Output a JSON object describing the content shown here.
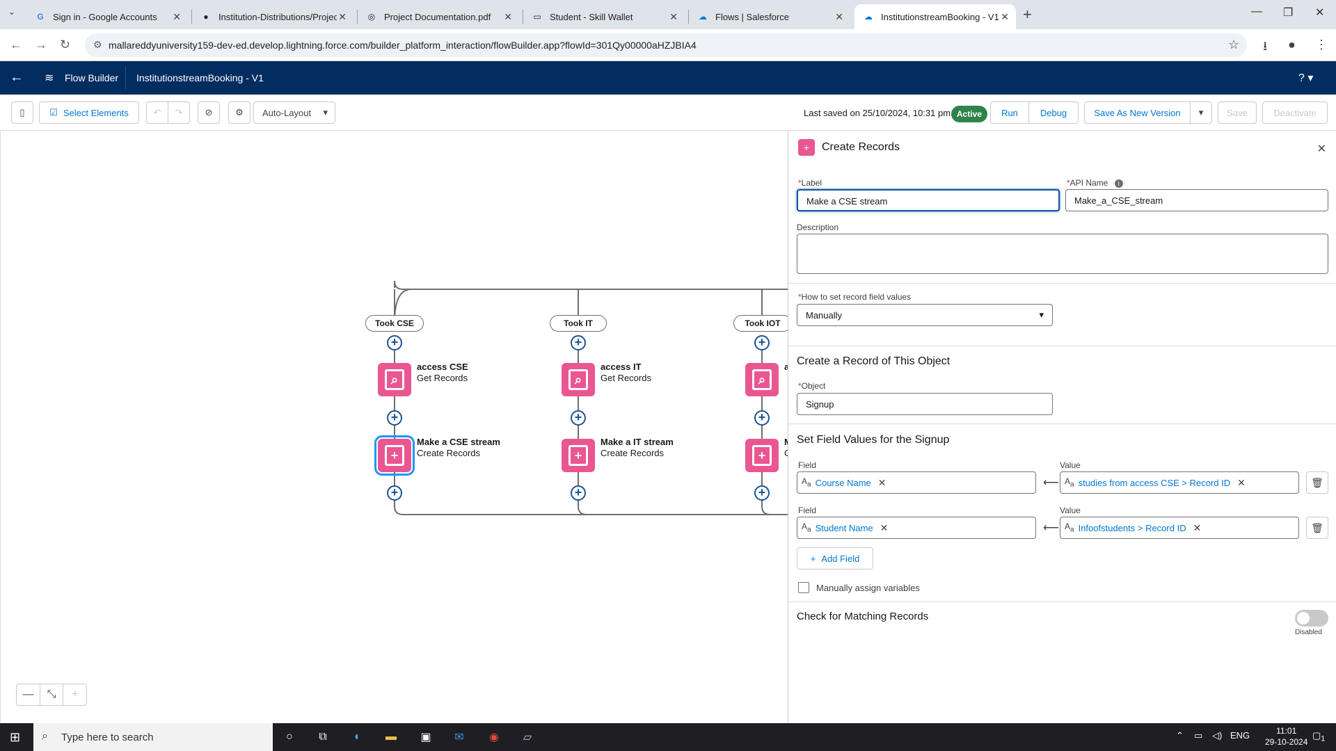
{
  "browser": {
    "tabs": [
      {
        "title": "Sign in - Google Accounts",
        "icon": "google-icon"
      },
      {
        "title": "Institution-Distributions/Project",
        "icon": "github-icon"
      },
      {
        "title": "Project Documentation.pdf",
        "icon": "globe-icon"
      },
      {
        "title": "Student - Skill Wallet",
        "icon": "page-icon"
      },
      {
        "title": "Flows | Salesforce",
        "icon": "salesforce-icon"
      },
      {
        "title": "InstitutionstreamBooking - V1",
        "icon": "salesforce-icon",
        "active": true
      }
    ],
    "url": "mallareddyuniversity159-dev-ed.develop.lightning.force.com/builder_platform_interaction/flowBuilder.app?flowId=301Qy00000aHZJBIA4"
  },
  "header": {
    "app_name": "Flow Builder",
    "flow_name": "InstitutionstreamBooking - V1",
    "help": "?"
  },
  "toolbar": {
    "select_elements": "Select Elements",
    "layout": "Auto-Layout",
    "last_saved": "Last saved on 25/10/2024, 10:31 pm",
    "status": "Active",
    "run": "Run",
    "debug": "Debug",
    "save_new_version": "Save As New Version",
    "save": "Save",
    "deactivate": "Deactivate"
  },
  "canvas": {
    "branches": [
      {
        "label": "Took CSE",
        "get_name": "access CSE",
        "get_type": "Get Records",
        "create_name": "Make a CSE stream",
        "create_type": "Create Records"
      },
      {
        "label": "Took IT",
        "get_name": "access IT",
        "get_type": "Get Records",
        "create_name": "Make a IT stream",
        "create_type": "Create Records"
      },
      {
        "label": "Took IOT",
        "get_name": "a",
        "create_name": "M",
        "create_type": "C"
      }
    ]
  },
  "panel": {
    "title": "Create Records",
    "label_label": "Label",
    "label_value": "Make a CSE stream",
    "api_label": "API Name",
    "api_value": "Make_a_CSE_stream",
    "description_label": "Description",
    "how_label": "How to set record field values",
    "how_value": "Manually",
    "section_object": "Create a Record of This Object",
    "object_label": "Object",
    "object_value": "Signup",
    "section_fields": "Set Field Values for the Signup",
    "field_label": "Field",
    "value_label": "Value",
    "rows": [
      {
        "field": "Course Name",
        "value": "studies from access CSE > Record ID"
      },
      {
        "field": "Student Name",
        "value": "Infoofstudents > Record ID"
      }
    ],
    "add_field": "Add Field",
    "manual_assign": "Manually assign variables",
    "section_matching": "Check for Matching Records",
    "toggle_state": "Disabled"
  },
  "taskbar": {
    "search_placeholder": "Type here to search",
    "lang": "ENG",
    "time": "11:01",
    "date": "29-10-2024",
    "notif": "1"
  },
  "colors": {
    "header_bg": "#032d60",
    "brand_blue": "#0176d3",
    "create_node": "#ea5692",
    "active_green": "#2e844a"
  }
}
